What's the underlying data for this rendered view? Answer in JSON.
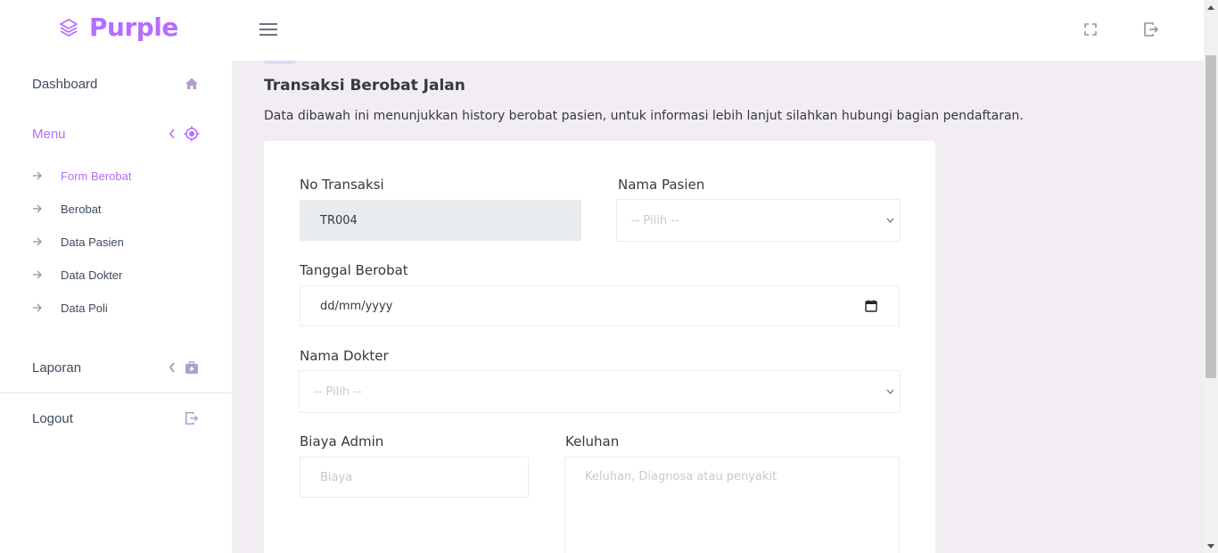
{
  "brand": {
    "name": "Purple",
    "icon": "layers-icon",
    "color": "#b66dff"
  },
  "navbar": {
    "menu_icon": "hamburger-icon",
    "fullscreen_icon": "fullscreen-icon",
    "logout_icon": "logout-icon"
  },
  "sidebar": {
    "dashboard": {
      "label": "Dashboard",
      "icon": "home-icon"
    },
    "menu": {
      "label": "Menu",
      "icon": "crosshair-icon"
    },
    "submenu": [
      {
        "label": "Form Berobat",
        "active": true
      },
      {
        "label": "Berobat"
      },
      {
        "label": "Data Pasien"
      },
      {
        "label": "Data Dokter"
      },
      {
        "label": "Data Poli"
      }
    ],
    "laporan": {
      "label": "Laporan",
      "icon": "medical-bag-icon"
    },
    "logout": {
      "label": "Logout",
      "icon": "logout-icon"
    }
  },
  "page": {
    "title": "Transaksi Berobat Jalan",
    "description": "Data dibawah ini menunjukkan history berobat pasien, untuk informasi lebih lanjut silahkan hubungi bagian pendaftaran."
  },
  "form": {
    "no_transaksi": {
      "label": "No Transaksi",
      "value": "TR004"
    },
    "nama_pasien": {
      "label": "Nama Pasien",
      "selected": "-- Pilih --"
    },
    "tanggal_berobat": {
      "label": "Tanggal Berobat",
      "placeholder": "dd/mm/yyyy"
    },
    "nama_dokter": {
      "label": "Nama Dokter",
      "selected": "-- Pilih --"
    },
    "biaya_admin": {
      "label": "Biaya Admin",
      "placeholder": "Biaya"
    },
    "keluhan": {
      "label": "Keluhan",
      "placeholder": "Keluhan, Diagnosa atau penyakit"
    }
  }
}
